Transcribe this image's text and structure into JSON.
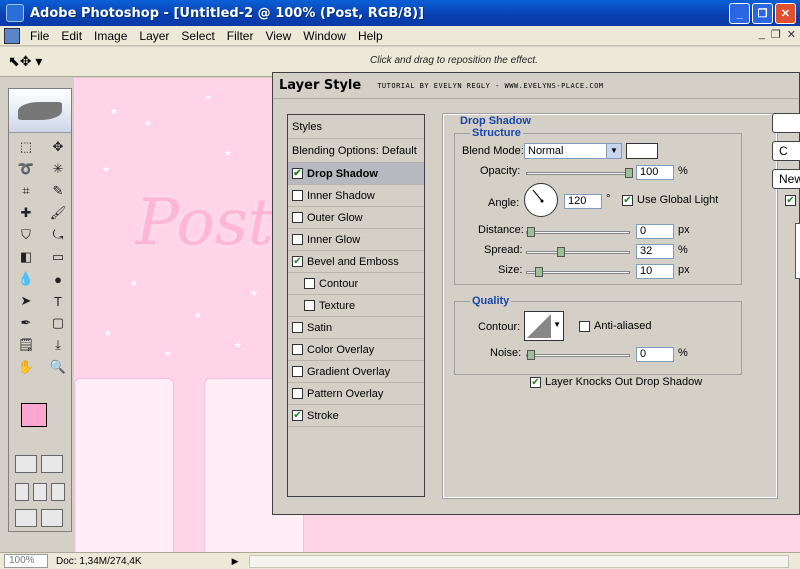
{
  "window": {
    "title": "Adobe Photoshop - [Untitled-2 @ 100% (Post, RGB/8)]"
  },
  "menu": [
    "File",
    "Edit",
    "Image",
    "Layer",
    "Select",
    "Filter",
    "View",
    "Window",
    "Help"
  ],
  "options_bar": {
    "hint": "Click and drag to reposition the effect."
  },
  "canvas": {
    "text": "Post"
  },
  "status": {
    "zoom": "100%",
    "doc": "Doc: 1,34M/274,4K"
  },
  "dialog": {
    "title": "Layer Style",
    "credit": "TUTORIAL BY EVELYN REGLY - WWW.EVELYNS-PLACE.COM",
    "styles": [
      {
        "label": "Styles",
        "type": "header"
      },
      {
        "label": "Blending Options: Default",
        "type": "header"
      },
      {
        "label": "Drop Shadow",
        "checked": true,
        "active": true
      },
      {
        "label": "Inner Shadow",
        "checked": false
      },
      {
        "label": "Outer Glow",
        "checked": false
      },
      {
        "label": "Inner Glow",
        "checked": false
      },
      {
        "label": "Bevel and Emboss",
        "checked": true
      },
      {
        "label": "Contour",
        "checked": false,
        "sub": true
      },
      {
        "label": "Texture",
        "checked": false,
        "sub": true
      },
      {
        "label": "Satin",
        "checked": false
      },
      {
        "label": "Color Overlay",
        "checked": false
      },
      {
        "label": "Gradient Overlay",
        "checked": false
      },
      {
        "label": "Pattern Overlay",
        "checked": false
      },
      {
        "label": "Stroke",
        "checked": true
      }
    ],
    "drop_shadow": {
      "section": "Drop Shadow",
      "structure": "Structure",
      "blend_mode_label": "Blend Mode:",
      "blend_mode": "Normal",
      "opacity_label": "Opacity:",
      "opacity": "100",
      "percent": "%",
      "angle_label": "Angle:",
      "angle": "120",
      "degree": "°",
      "use_global_light": "Use Global Light",
      "distance_label": "Distance:",
      "distance": "0",
      "spread_label": "Spread:",
      "spread": "32",
      "size_label": "Size:",
      "size": "10",
      "px": "px",
      "quality": "Quality",
      "contour_label": "Contour:",
      "anti_aliased": "Anti-aliased",
      "noise_label": "Noise:",
      "noise": "0",
      "knocks_out": "Layer Knocks Out Drop Shadow"
    },
    "buttons": {
      "new": "New"
    }
  },
  "colors": {
    "canvas_pink": "#ffd4e6",
    "foreground": "#ffa6d2",
    "section_blue": "#1846a8"
  }
}
